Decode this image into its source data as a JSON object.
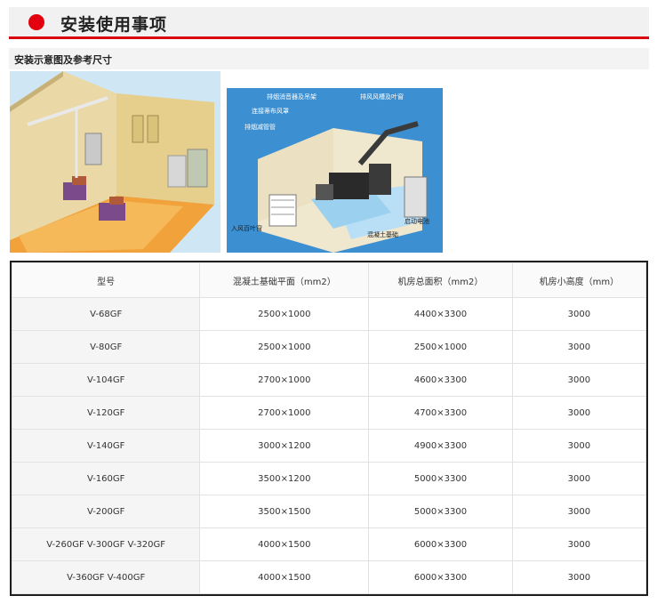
{
  "header": {
    "title": "安装使用事项",
    "accent_color": "#e3000f"
  },
  "section": {
    "subtitle": "安装示意图及参考尺寸"
  },
  "diagram2": {
    "labels": {
      "muffler": "排烟消音器及吊架",
      "connector": "连接蒂布风罩",
      "exhaust_pipe": "排烟减管管",
      "exhaust_louver": "排风风槽及叶窗",
      "intake_louver": "入风百叶窗",
      "battery": "启动电池",
      "foundation": "混凝土基础"
    }
  },
  "table": {
    "headers": [
      "型号",
      "混凝土基础平面（mm2）",
      "机房总面积（mm2）",
      "机房小高度（mm）"
    ],
    "rows": [
      [
        "V-68GF",
        "2500×1000",
        "4400×3300",
        "3000"
      ],
      [
        "V-80GF",
        "2500×1000",
        "2500×1000",
        "3000"
      ],
      [
        "V-104GF",
        "2700×1000",
        "4600×3300",
        "3000"
      ],
      [
        "V-120GF",
        "2700×1000",
        "4700×3300",
        "3000"
      ],
      [
        "V-140GF",
        "3000×1200",
        "4900×3300",
        "3000"
      ],
      [
        "V-160GF",
        "3500×1200",
        "5000×3300",
        "3000"
      ],
      [
        "V-200GF",
        "3500×1500",
        "5000×3300",
        "3000"
      ],
      [
        "V-260GF V-300GF V-320GF",
        "4000×1500",
        "6000×3300",
        "3000"
      ],
      [
        "V-360GF V-400GF",
        "4000×1500",
        "6000×3300",
        "3000"
      ]
    ]
  }
}
